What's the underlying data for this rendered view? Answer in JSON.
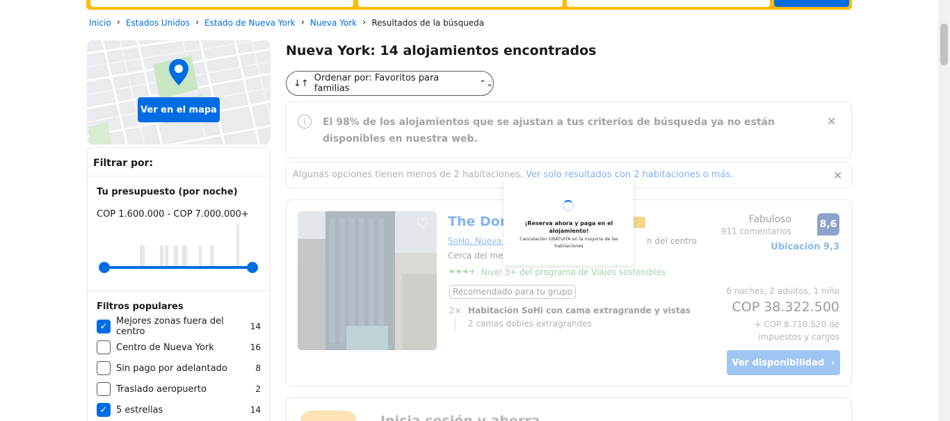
{
  "breadcrumb": {
    "items": [
      "Inicio",
      "Estados Unidos",
      "Estado de Nueva York",
      "Nueva York"
    ],
    "current": "Resultados de la búsqueda"
  },
  "map": {
    "button_label": "Ver en el mapa"
  },
  "filters": {
    "title": "Filtrar por:",
    "budget": {
      "title": "Tu presupuesto (por noche)",
      "range": "COP 1.600.000 - COP 7.000.000+"
    },
    "popular": {
      "title": "Filtros populares",
      "items": [
        {
          "label": "Mejores zonas fuera del centro",
          "count": "14",
          "checked": true
        },
        {
          "label": "Centro de Nueva York",
          "count": "16",
          "checked": false
        },
        {
          "label": "Sin pago por adelantado",
          "count": "8",
          "checked": false
        },
        {
          "label": "Traslado aeropuerto",
          "count": "2",
          "checked": false
        },
        {
          "label": "5 estrellas",
          "count": "14",
          "checked": true
        }
      ]
    }
  },
  "results": {
    "title": "Nueva York: 14 alojamientos encontrados",
    "sort_label": "Ordenar por: Favoritos para familias",
    "alert_main": "El 98% de los alojamientos que se ajustan a tus criterios de búsqueda ya no están disponibles en nuestra web.",
    "alert_rooms_text": "Algunas opciones tienen menos de 2 habitaciones. ",
    "alert_rooms_link": "Ver solo resultados con 2 habitaciones o más.",
    "card": {
      "name": "The Dom",
      "location_link": "SoHo, Nueva Y",
      "location_extra": "n del centro",
      "near": "Cerca del metro",
      "sustainability": "Nivel 3+ del programa de Viajes sostenibles",
      "badge": "Recomendado para tu grupo",
      "room_qty": "2×",
      "room_name": "Habitación SoHi con cama extragrande y vistas",
      "room_beds": "2 camas dobles extragrandes",
      "score_word": "Fabuloso",
      "reviews": "911 comentarios",
      "score": "8,6",
      "location_score": "Ubicación 9,3",
      "stay": "6 noches, 2 adultos, 1 niño",
      "price": "COP 38.322.500",
      "taxes": "+ COP 8.710.520 de impuestos y cargos",
      "cta": "Ver disponibilidad"
    },
    "next_card_title": "Inicia sesión y ahorra"
  },
  "popup": {
    "title": "¡Reserva ahora y paga en el alojamiento!",
    "subtitle": "Cancelación GRATUITA en la mayoría de las habitaciones"
  },
  "colors": {
    "brand_blue": "#006ce4",
    "brand_yellow": "#febb02"
  }
}
